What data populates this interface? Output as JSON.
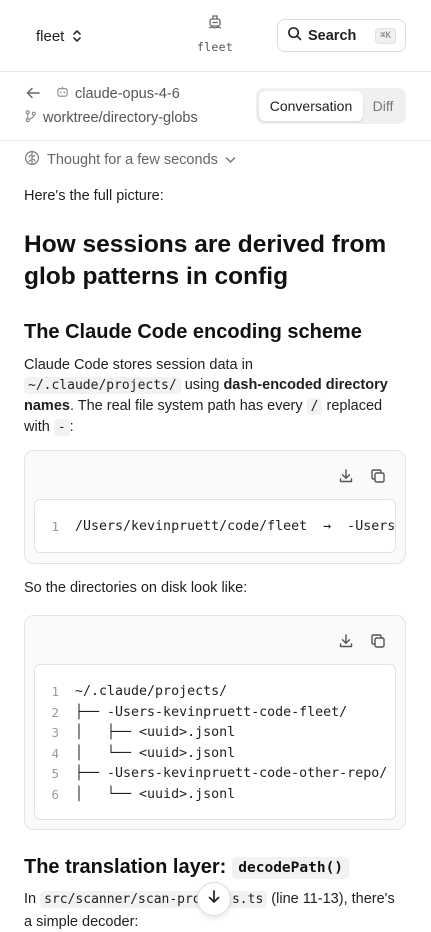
{
  "topbar": {
    "repo": "fleet",
    "brand": "fleet",
    "search_label": "Search",
    "search_shortcut": "⌘K"
  },
  "session": {
    "model": "claude-opus-4-6",
    "branch": "worktree/directory-globs",
    "tabs": [
      {
        "label": "Conversation",
        "active": true
      },
      {
        "label": "Diff",
        "active": false
      }
    ]
  },
  "message": {
    "thought": "Thought for a few seconds",
    "intro": "Here's the full picture:",
    "title": "How sessions are derived from glob patterns in config",
    "section1_heading": "The Claude Code encoding scheme",
    "section1_para": {
      "t1": "Claude Code stores session data in",
      "code1": "~/.claude/projects/",
      "t2": " using ",
      "bold": "dash-encoded directory names",
      "t3": ". The real file system path has every ",
      "code2": "/",
      "t4": " replaced with ",
      "code3": "-",
      "t5": ":"
    },
    "code_block_1": {
      "lines": [
        {
          "n": "1",
          "text": "/Users/kevinpruett/code/fleet  →  -Users-kevinpruett-code-fleet"
        }
      ]
    },
    "para2": "So the directories on disk look like:",
    "code_block_2": {
      "lines": [
        {
          "n": "1",
          "text": "~/.claude/projects/"
        },
        {
          "n": "2",
          "text": "├── -Users-kevinpruett-code-fleet/"
        },
        {
          "n": "3",
          "text": "│   ├── <uuid>.jsonl"
        },
        {
          "n": "4",
          "text": "│   └── <uuid>.jsonl"
        },
        {
          "n": "5",
          "text": "├── -Users-kevinpruett-code-other-repo/"
        },
        {
          "n": "6",
          "text": "│   └── <uuid>.jsonl"
        }
      ]
    },
    "section2_heading": "The translation layer:",
    "section2_code": "decodePath()",
    "section2_para": {
      "t1": "In ",
      "code": "src/scanner/scan-projects.ts",
      "t2": " (line 11-13), there's a simple decoder:"
    }
  },
  "icons": {
    "back": "arrow-left-icon",
    "model": "bot-icon",
    "branch": "git-branch-icon",
    "search": "search-icon",
    "thought": "brain-icon",
    "download": "download-icon",
    "copy": "copy-icon",
    "scroll": "arrow-down-icon"
  }
}
